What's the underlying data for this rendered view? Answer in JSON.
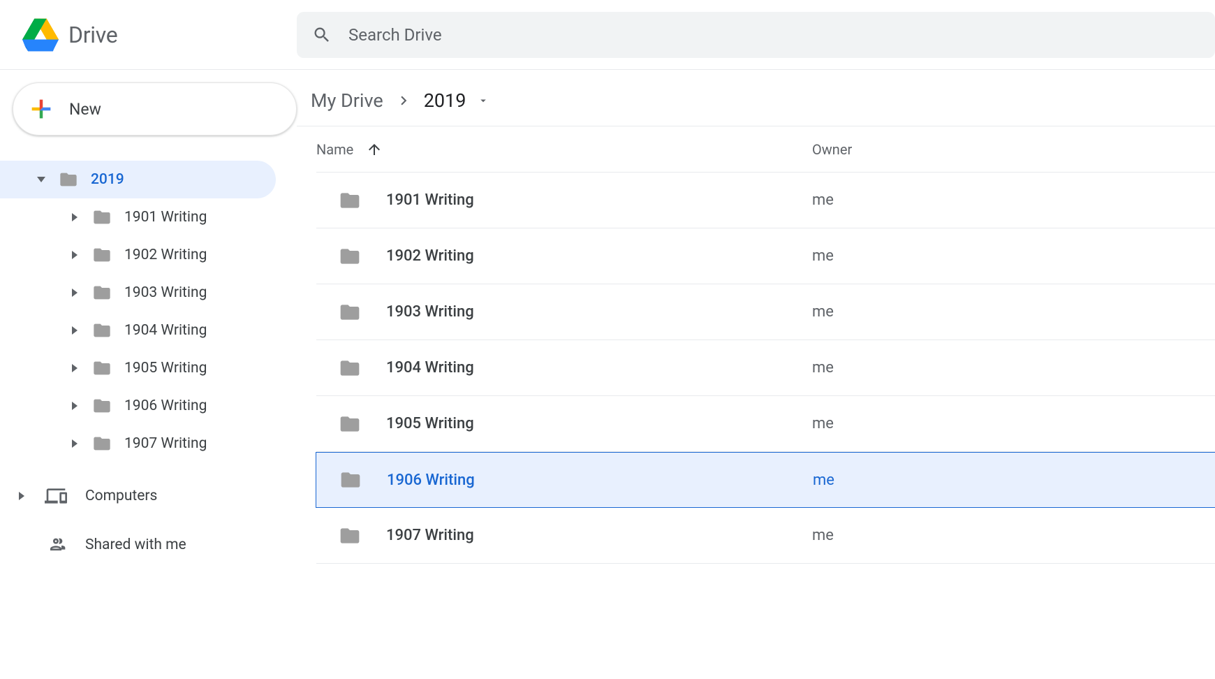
{
  "header": {
    "app_name": "Drive",
    "search_placeholder": "Search Drive"
  },
  "sidebar": {
    "new_button_label": "New",
    "tree": {
      "root_label": "2019",
      "children": [
        {
          "label": "1901 Writing"
        },
        {
          "label": "1902 Writing"
        },
        {
          "label": "1903 Writing"
        },
        {
          "label": "1904 Writing"
        },
        {
          "label": "1905 Writing"
        },
        {
          "label": "1906 Writing"
        },
        {
          "label": "1907 Writing"
        }
      ]
    },
    "nav": [
      {
        "label": "Computers",
        "icon": "computers"
      },
      {
        "label": "Shared with me",
        "icon": "shared"
      }
    ]
  },
  "breadcrumb": [
    "My Drive",
    "2019"
  ],
  "table": {
    "columns": {
      "name": "Name",
      "owner": "Owner"
    },
    "sort_asc": true,
    "rows": [
      {
        "name": "1901 Writing",
        "owner": "me",
        "selected": false
      },
      {
        "name": "1902 Writing",
        "owner": "me",
        "selected": false
      },
      {
        "name": "1903 Writing",
        "owner": "me",
        "selected": false
      },
      {
        "name": "1904 Writing",
        "owner": "me",
        "selected": false
      },
      {
        "name": "1905 Writing",
        "owner": "me",
        "selected": false
      },
      {
        "name": "1906 Writing",
        "owner": "me",
        "selected": true
      },
      {
        "name": "1907 Writing",
        "owner": "me",
        "selected": false
      }
    ]
  }
}
